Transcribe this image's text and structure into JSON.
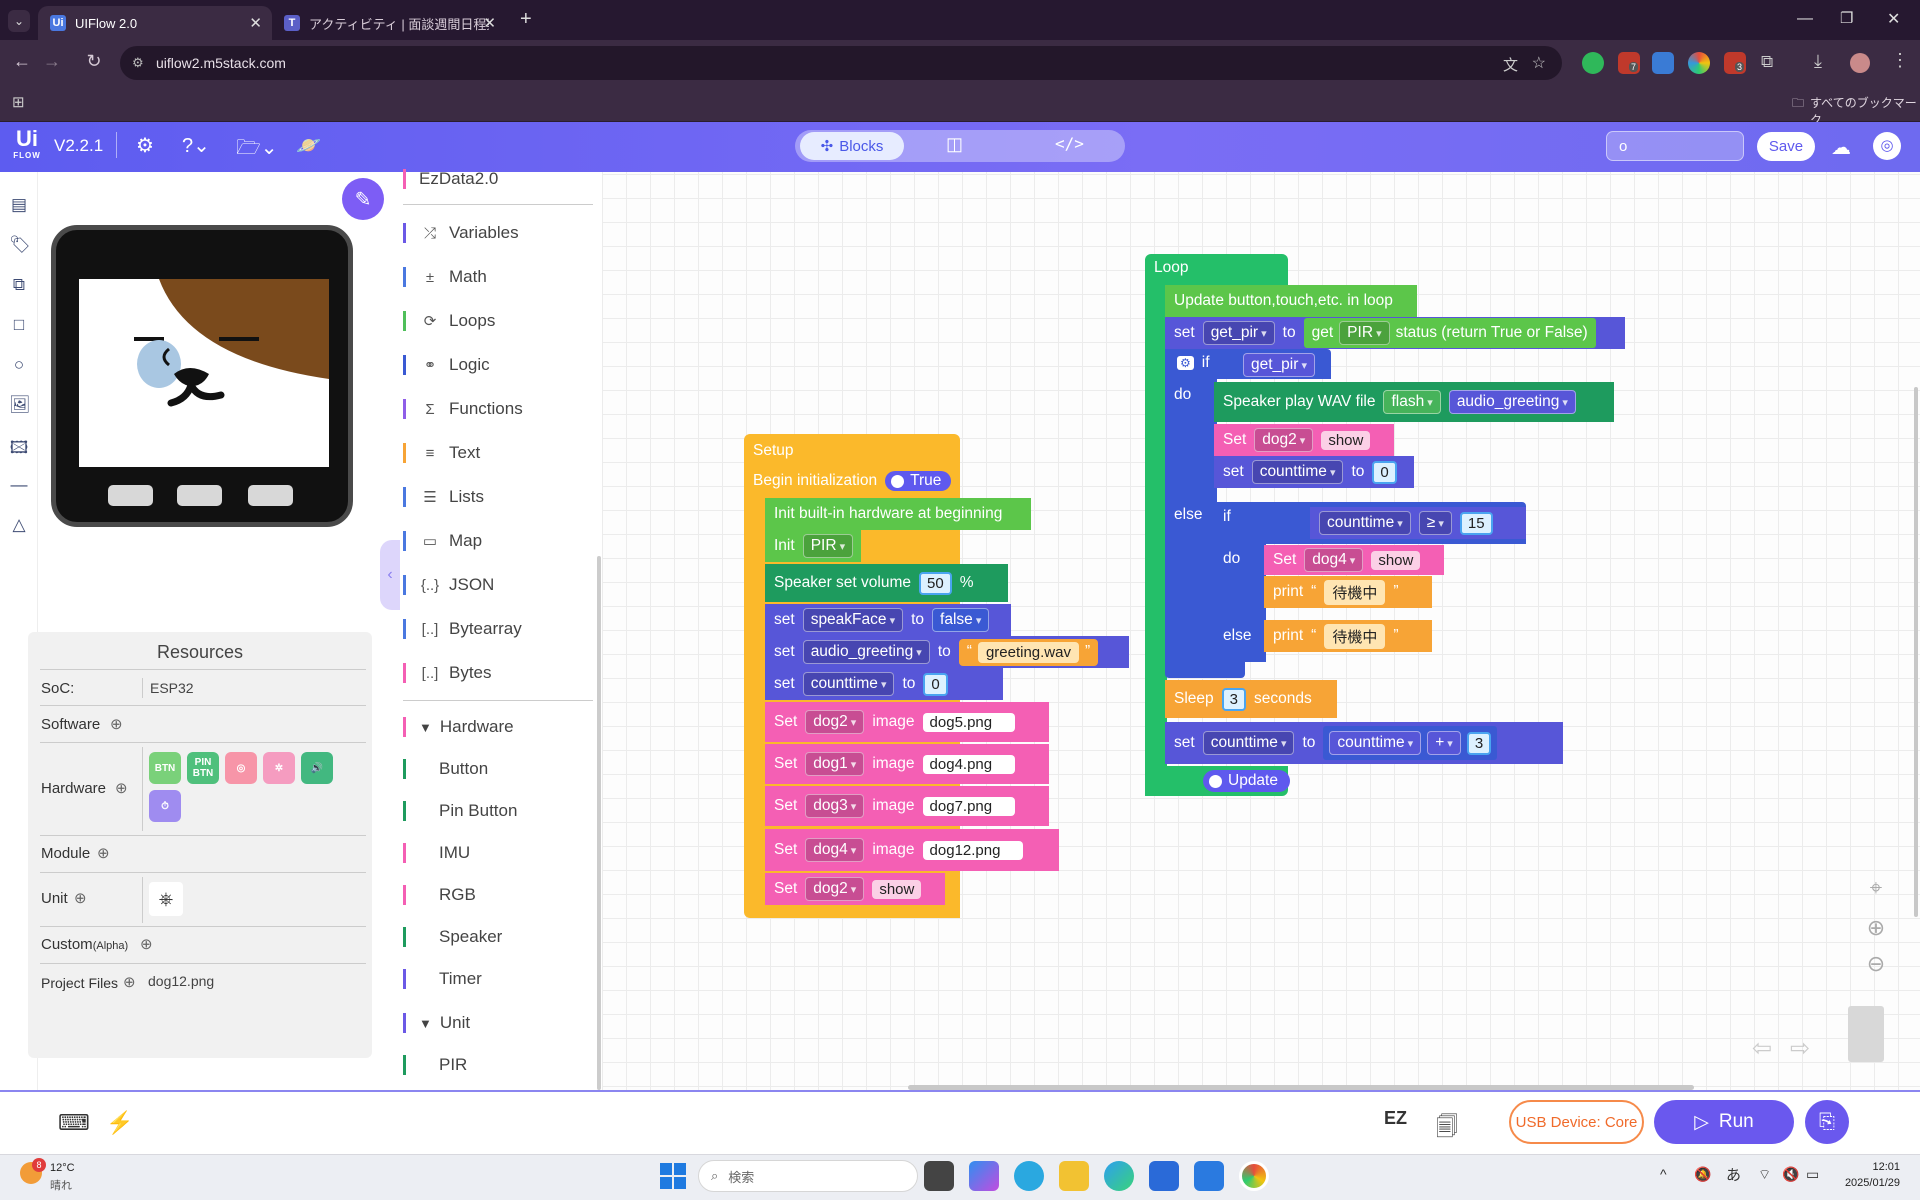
{
  "browser": {
    "tabs": [
      {
        "title": "UIFlow 2.0",
        "icon": "Ui"
      },
      {
        "title": "アクティビティ | 面談週間日程案 | M",
        "icon": "teams"
      }
    ],
    "url": "uiflow2.m5stack.com",
    "bookmarks_label": "すべてのブックマーク",
    "ext_badges": [
      "7",
      "3"
    ]
  },
  "header": {
    "logo_top": "Ui",
    "logo_bottom": "FLOW",
    "version": "V2.2.1",
    "modes": [
      "Blocks",
      "split",
      "code"
    ],
    "project_name": "o",
    "save_label": "Save"
  },
  "resources": {
    "title": "Resources",
    "soc_label": "SoC:",
    "soc_value": "ESP32",
    "software_label": "Software",
    "hardware_label": "Hardware",
    "hardware_badges": [
      {
        "label": "BTN",
        "color": "#7ad17a"
      },
      {
        "label": "PIN BTN",
        "color": "#4fc07c"
      },
      {
        "label": "◎",
        "color": "#f795a8"
      },
      {
        "label": "✲",
        "color": "#f59cc0"
      },
      {
        "label": "🔊",
        "color": "#42b880"
      },
      {
        "label": "⏱",
        "color": "#9f8cf0"
      }
    ],
    "module_label": "Module",
    "unit_label": "Unit",
    "custom_label": "Custom",
    "custom_sub": "(Alpha)",
    "files_label": "Project Files",
    "files_value": "dog12.png"
  },
  "categories": {
    "top": "EzData2.0",
    "items": [
      {
        "label": "Variables",
        "icon": "⤮",
        "color": "#6b59e6"
      },
      {
        "label": "Math",
        "icon": "±",
        "color": "#4a78e0"
      },
      {
        "label": "Loops",
        "icon": "⟳",
        "color": "#4fbf5a"
      },
      {
        "label": "Logic",
        "icon": "⚭",
        "color": "#3a59d3"
      },
      {
        "label": "Functions",
        "icon": "Σ",
        "color": "#8f5ee8"
      },
      {
        "label": "Text",
        "icon": "≡",
        "color": "#f7a436"
      },
      {
        "label": "Lists",
        "icon": "☰",
        "color": "#4a78e0"
      },
      {
        "label": "Map",
        "icon": "▭",
        "color": "#4a78e0"
      },
      {
        "label": "JSON",
        "icon": "{..}",
        "color": "#4a78e0"
      },
      {
        "label": "Bytearray",
        "icon": "[..]",
        "color": "#4a78e0"
      },
      {
        "label": "Bytes",
        "icon": "[..]",
        "color": "#f45fb4"
      }
    ],
    "hardware_header": "Hardware",
    "hardware_items": [
      {
        "label": "Button",
        "color": "#1e9b5e"
      },
      {
        "label": "Pin Button",
        "color": "#1e9b5e"
      },
      {
        "label": "IMU",
        "color": "#f45fb4"
      },
      {
        "label": "RGB",
        "color": "#f45fb4"
      },
      {
        "label": "Speaker",
        "color": "#1e9b5e"
      },
      {
        "label": "Timer",
        "color": "#6b59e6"
      }
    ],
    "unit_header": "Unit",
    "unit_items": [
      {
        "label": "PIR",
        "color": "#1e9b5e"
      }
    ]
  },
  "setup": {
    "title": "Setup",
    "begin": "Begin initialization",
    "begin_val": "True",
    "init_hw": "Init built-in hardware at beginning",
    "init": "Init",
    "init_sel": "PIR",
    "vol_label": "Speaker set volume",
    "vol_val": "50",
    "vol_unit": "%",
    "set": "set",
    "to": "to",
    "var1": "speakFace",
    "var1_val": "false",
    "var2": "audio_greeting",
    "var2_val": "greeting.wav",
    "var3": "counttime",
    "var3_val": "0",
    "set_cap": "Set",
    "image": "image",
    "imgs": [
      {
        "name": "dog2",
        "file": "dog5.png"
      },
      {
        "name": "dog1",
        "file": "dog4.png"
      },
      {
        "name": "dog3",
        "file": "dog7.png"
      },
      {
        "name": "dog4",
        "file": "dog12.png"
      }
    ],
    "last_name": "dog2",
    "last_val": "show"
  },
  "loop": {
    "title": "Loop",
    "update_btn": "Update button,touch,etc. in loop",
    "set": "set",
    "to": "to",
    "get_pir": "get_pir",
    "get": "get",
    "pir": "PIR",
    "status": "status (return True or False)",
    "if": "if",
    "do": "do",
    "else": "else",
    "play": "Speaker play WAV file",
    "flash": "flash",
    "greeting": "audio_greeting",
    "set_cap": "Set",
    "dog2": "dog2",
    "show": "show",
    "counttime": "counttime",
    "zero": "0",
    "ge": "≥",
    "fifteen": "15",
    "dog4": "dog4",
    "print": "print",
    "waiting": "待機中",
    "sleep": "Sleep",
    "sleep_val": "3",
    "seconds": "seconds",
    "plus": "+",
    "three": "3",
    "update": "Update"
  },
  "bottom": {
    "usb_label": "USB Device: Core",
    "run_label": "Run",
    "ez_label": "EZ"
  },
  "taskbar": {
    "weather_temp": "12°C",
    "weather_desc": "晴れ",
    "weather_badge": "8",
    "search_placeholder": "検索",
    "time": "12:01",
    "date": "2025/01/29",
    "ime": "あ"
  }
}
